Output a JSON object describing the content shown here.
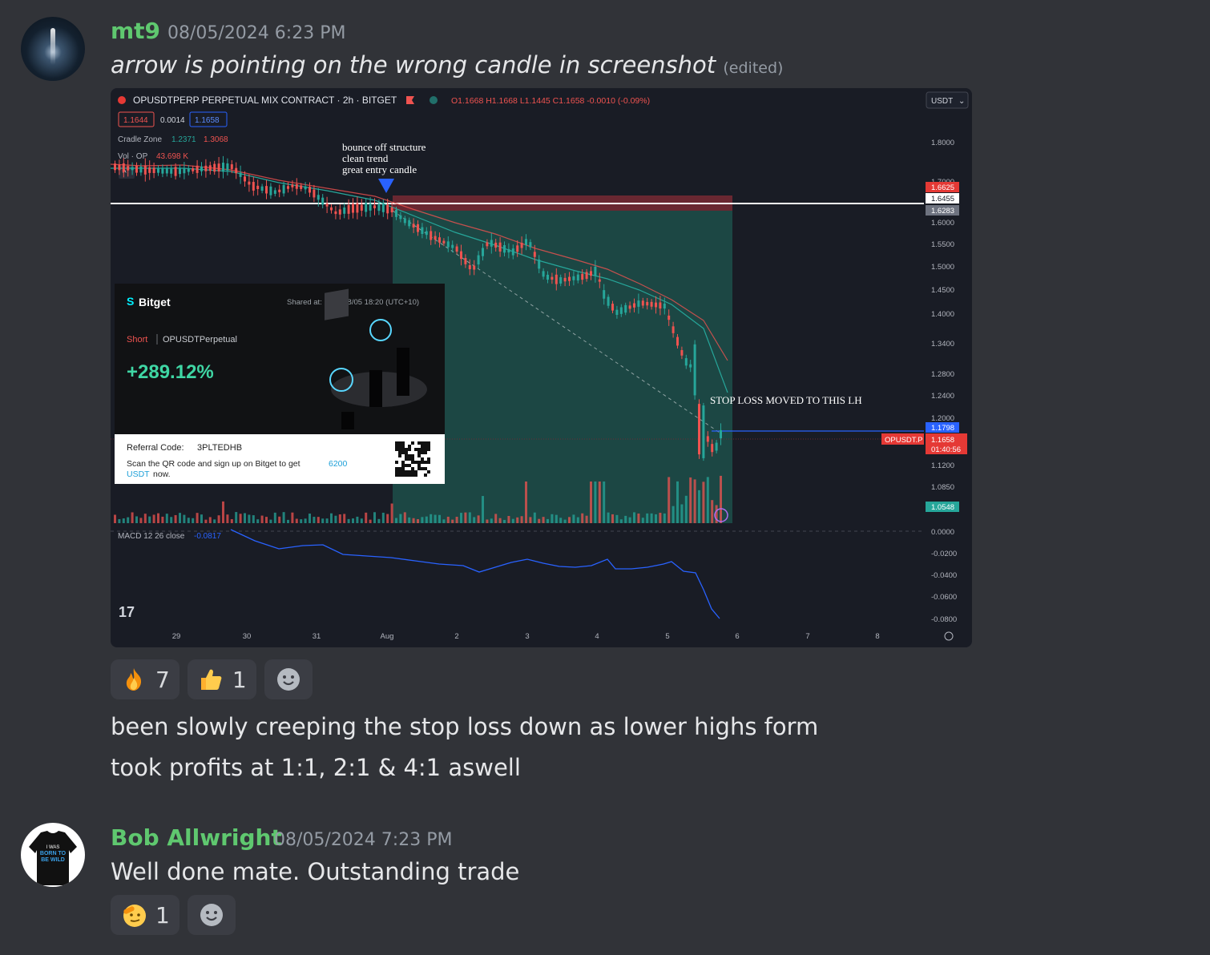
{
  "messages": [
    {
      "username": "mt9",
      "timestamp": "08/05/2024 6:23 PM",
      "text": "arrow is pointing on the wrong candle in screenshot",
      "edited_label": "(edited)",
      "reactions": [
        {
          "emoji": "fire-emoji",
          "count": "7"
        },
        {
          "emoji": "thumbs-up-emoji",
          "count": "1"
        }
      ],
      "followups": [
        "been slowly creeping the stop loss down as lower highs form",
        "took profits at 1:1, 2:1 & 4:1 aswell"
      ]
    },
    {
      "username": "Bob Allwright",
      "timestamp": "08/05/2024 7:23 PM",
      "text": "Well done mate. Outstanding trade",
      "reactions": [
        {
          "emoji": "saluting-face-emoji",
          "count": "1"
        }
      ],
      "avatar_text": [
        "I WAS",
        "BORN TO",
        "BE WILD"
      ]
    }
  ],
  "chart": {
    "header": "OPUSDTPERP PERPETUAL MIX CONTRACT · 2h · BITGET",
    "ohlc": "O1.1668 H1.1668 L1.1445 C1.1658 -0.0010 (-0.09%)",
    "bid": "1.1644",
    "spread": "0.0014",
    "ask": "1.1658",
    "cradle_label": "Cradle Zone",
    "cradle_v1": "1.2371",
    "cradle_v2": "1.3068",
    "vol_label": "Vol · OP",
    "vol_value": "43.698 K",
    "currency": "USDT",
    "annotation_lines": [
      "bounce off structure",
      "clean trend",
      "great entry candle"
    ],
    "stop_loss_note": "STOP LOSS MOVED TO THIS LH",
    "price_labels": [
      "1.8000",
      "1.7000",
      "1.6000",
      "1.5500",
      "1.5000",
      "1.4500",
      "1.4000",
      "1.3400",
      "1.2800",
      "1.2400",
      "1.2000",
      "1.1200",
      "1.0850"
    ],
    "price_tags": {
      "stop": "1.6625",
      "entry": "1.6455",
      "tp": "1.6283",
      "sl_line": "1.1798",
      "symbol": "OPUSDT.P",
      "current": "1.1658",
      "countdown": "01:40:56",
      "target": "1.0548"
    },
    "macd_label": "MACD 12 26 close",
    "macd_value": "-0.0817",
    "macd_ticks": [
      "0.0000",
      "-0.0200",
      "-0.0400",
      "-0.0600",
      "-0.0800"
    ],
    "date_labels": [
      "29",
      "30",
      "31",
      "Aug",
      "2",
      "3",
      "4",
      "5",
      "6",
      "7",
      "8"
    ],
    "tv_logo": "17"
  },
  "bitget_card": {
    "brand": "Bitget",
    "shared_at": "Shared at: 2024/08/05 18:20 (UTC+10)",
    "side": "Short",
    "pair": "OPUSDTPerpetual",
    "pnl": "+289.12%",
    "referral_label": "Referral Code:",
    "referral_code": "3PLTEDHB",
    "promo_text": "Scan the QR code and sign up on Bitget to get",
    "promo_amount": "6200",
    "promo_unit": "USDT",
    "promo_end": "now."
  },
  "colors": {
    "background": "#313338",
    "username": "#5fc86f",
    "bullish": "#26a69a",
    "bearish": "#ef5350",
    "accent_blue": "#2962ff"
  }
}
